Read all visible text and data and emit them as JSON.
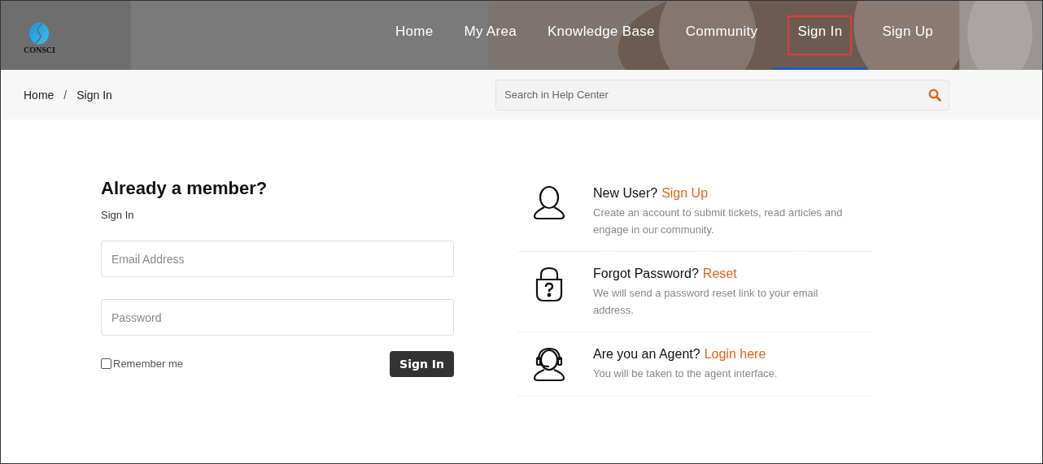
{
  "header": {
    "logo_text": "CONSCI",
    "nav": [
      {
        "label": "Home",
        "selected": false,
        "highlighted": false
      },
      {
        "label": "My Area",
        "selected": false,
        "highlighted": false
      },
      {
        "label": "Knowledge Base",
        "selected": false,
        "highlighted": false
      },
      {
        "label": "Community",
        "selected": false,
        "highlighted": false
      },
      {
        "label": "Sign In",
        "selected": true,
        "highlighted": true
      },
      {
        "label": "Sign Up",
        "selected": false,
        "highlighted": false
      }
    ]
  },
  "breadcrumb": {
    "items": [
      "Home",
      "Sign In"
    ],
    "separator": "/"
  },
  "search": {
    "placeholder": "Search in Help Center"
  },
  "login": {
    "title": "Already a member?",
    "subtitle": "Sign In",
    "fields": [
      {
        "placeholder": "Email Address"
      },
      {
        "placeholder": "Password"
      }
    ],
    "remember": {
      "label": "Remember me",
      "checked": false
    },
    "submit": "Sign In"
  },
  "options": [
    {
      "kind": "user",
      "question": "New User?",
      "link": "Sign Up",
      "description": "Create an account to submit tickets, read articles and engage in our community."
    },
    {
      "kind": "lock",
      "question": "Forgot Password?",
      "link": "Reset",
      "description": "We will send a password reset link to your email address."
    },
    {
      "kind": "agent",
      "question": "Are you an Agent?",
      "link": "Login here",
      "description": "You will be taken to the agent interface."
    }
  ]
}
